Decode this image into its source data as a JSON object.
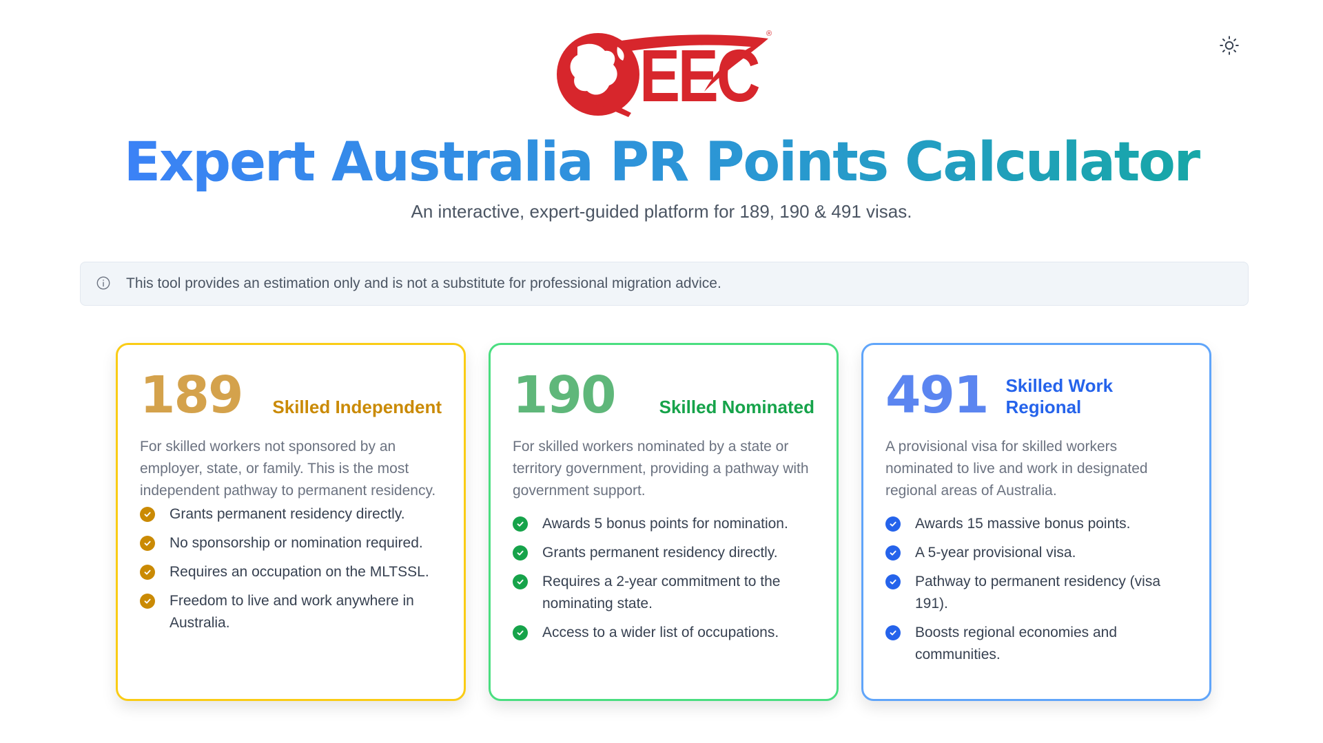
{
  "brand": {
    "logo_text": "EEC",
    "registered_mark": "®"
  },
  "theme_toggle": {
    "icon": "sun-icon"
  },
  "header": {
    "title": "Expert Australia PR Points Calculator",
    "subtitle": "An interactive, expert-guided platform for 189, 190 & 491 visas."
  },
  "notice": {
    "icon": "info-icon",
    "text": "This tool provides an estimation only and is not a substitute for professional migration advice."
  },
  "colors": {
    "c189": "#ca8a04",
    "c190": "#16a34a",
    "c491": "#2563eb",
    "logo_red": "#d7262c"
  },
  "cards": [
    {
      "number": "189",
      "name": "Skilled Independent",
      "description": "For skilled workers not sponsored by an employer, state, or family. This is the most independent pathway to permanent residency.",
      "features": [
        "Grants permanent residency directly.",
        "No sponsorship or nomination required.",
        "Requires an occupation on the MLTSSL.",
        "Freedom to live and work anywhere in Australia."
      ]
    },
    {
      "number": "190",
      "name": "Skilled Nominated",
      "description": "For skilled workers nominated by a state or territory government, providing a pathway with government support.",
      "features": [
        "Awards 5 bonus points for nomination.",
        "Grants permanent residency directly.",
        "Requires a 2-year commitment to the nominating state.",
        "Access to a wider list of occupations."
      ]
    },
    {
      "number": "491",
      "name": "Skilled Work Regional",
      "description": "A provisional visa for skilled workers nominated to live and work in designated regional areas of Australia.",
      "features": [
        "Awards 15 massive bonus points.",
        "A 5-year provisional visa.",
        "Pathway to permanent residency (visa 191).",
        "Boosts regional economies and communities."
      ]
    }
  ]
}
